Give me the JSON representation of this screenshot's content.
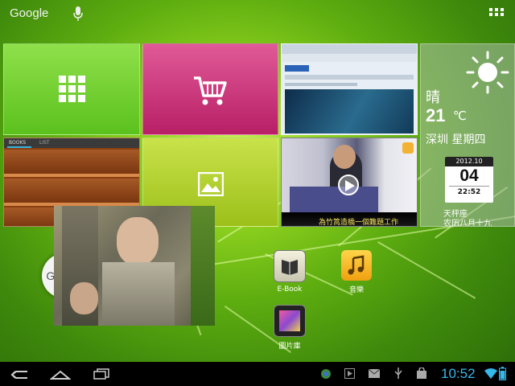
{
  "topbar": {
    "google_label": "Google"
  },
  "weather": {
    "condition": "晴",
    "temperature": "21",
    "unit": "℃",
    "location_day": "深圳 星期四",
    "year_month": "2012.10",
    "day": "04",
    "time": "22:52",
    "zodiac": "天枰座",
    "lunar": "农历八月十九"
  },
  "books_tile": {
    "tab_books": "BOOKS",
    "tab_list": "LIST"
  },
  "video_tile": {
    "caption": "為竹篙造橋一個難題工作"
  },
  "search_circle": {
    "label": "Google"
  },
  "shortcuts": [
    {
      "label": "E-Book"
    },
    {
      "label": "音樂"
    },
    {
      "label": "圖片庫"
    }
  ],
  "statusbar": {
    "clock": "10:52"
  }
}
